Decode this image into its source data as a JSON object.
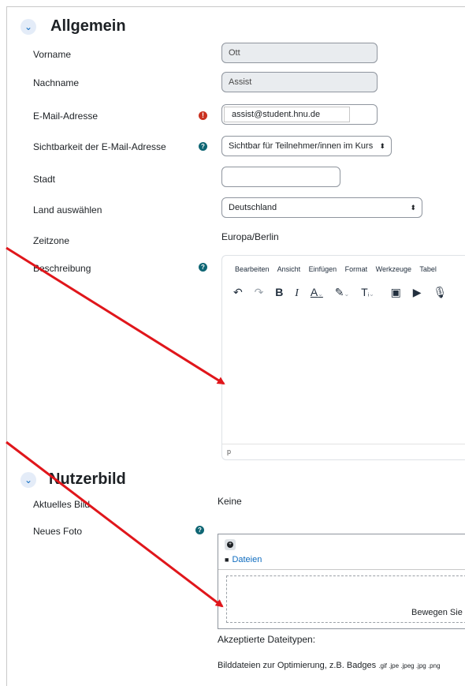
{
  "sections": {
    "allgemein": {
      "title": "Allgemein",
      "toggle_icon": "chevron-down-icon"
    },
    "nutzerbild": {
      "title": "Nutzerbild",
      "toggle_icon": "chevron-down-icon"
    }
  },
  "fields": {
    "vorname": {
      "label": "Vorname",
      "value": "Ott"
    },
    "nachname": {
      "label": "Nachname",
      "value": "Assist"
    },
    "email": {
      "label": "E-Mail-Adresse",
      "value": "assist@student.hnu.de",
      "required_icon": "!"
    },
    "email_visibility": {
      "label": "Sichtbarkeit der E-Mail-Adresse",
      "value": "Sichtbar für Teilnehmer/innen im Kurs",
      "help_icon": "?"
    },
    "stadt": {
      "label": "Stadt",
      "value": ""
    },
    "land": {
      "label": "Land auswählen",
      "value": "Deutschland"
    },
    "zeitzone": {
      "label": "Zeitzone",
      "value": "Europa/Berlin"
    },
    "beschreibung": {
      "label": "Beschreibung",
      "help_icon": "?"
    }
  },
  "editor": {
    "menu": [
      "Bearbeiten",
      "Ansicht",
      "Einfügen",
      "Format",
      "Werkzeuge",
      "Tabel"
    ],
    "statusbar_text": "p"
  },
  "nutzerbild": {
    "aktuelles_bild_label": "Aktuelles Bild",
    "aktuelles_bild_value": "Keine",
    "neues_foto_label": "Neues Foto",
    "help_icon": "?",
    "files_folder": "Dateien",
    "drop_hint": "Bewegen Sie L",
    "accepted_types_label": "Akzeptierte Dateitypen:",
    "accepted_types_desc": "Bilddateien zur Optimierung, z.B. Badges",
    "accepted_types_ext": ".gif .jpe .jpeg .jpg .png"
  },
  "annotation": {
    "arrow_color": "#e0161b"
  }
}
